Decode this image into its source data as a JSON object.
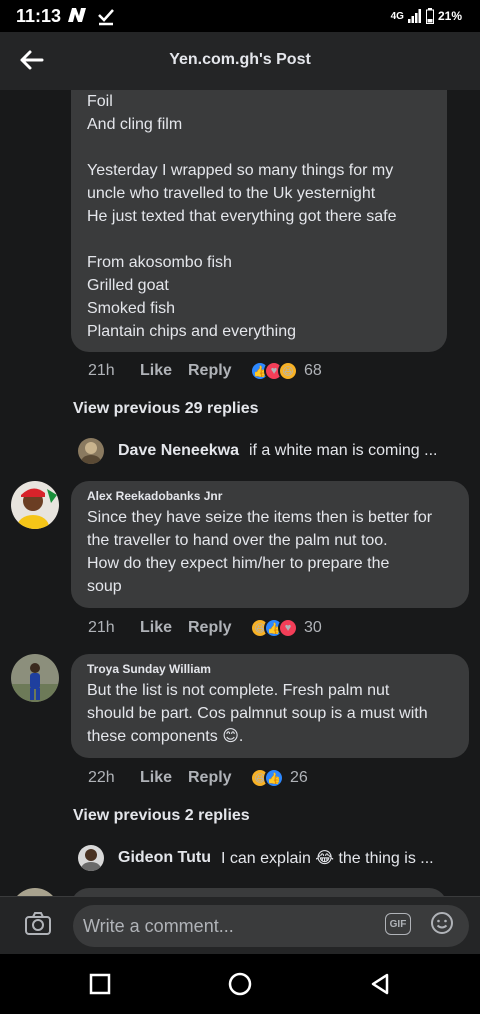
{
  "status_bar": {
    "time": "11:13",
    "network": "4G",
    "battery": "21%"
  },
  "header": {
    "title": "Yen.com.gh's Post"
  },
  "comment1": {
    "lines": [
      "Foil",
      "And cling film",
      "",
      "Yesterday I wrapped so many things for my",
      "uncle who travelled to the Uk yesternight",
      "He just texted that everything got there safe",
      "",
      "From akosombo fish",
      "Grilled goat",
      "Smoked fish",
      "Plantain chips and everything"
    ],
    "time": "21h",
    "like": "Like",
    "reply": "Reply",
    "reaction_count": "68",
    "view_previous": "View previous 29 replies",
    "reply_preview": {
      "name": "Dave Neneekwa",
      "text": "if a white man is coming ..."
    }
  },
  "comment2": {
    "author": "Alex Reekadobanks Jnr",
    "lines": [
      "Since they have seize the items then is better for",
      "the traveller to hand over the palm nut too.",
      "How do they expect him/her to prepare the",
      "soup"
    ],
    "time": "21h",
    "like": "Like",
    "reply": "Reply",
    "reaction_count": "30"
  },
  "comment3": {
    "author": "Troya Sunday William",
    "lines": [
      "But the list is not complete. Fresh palm nut",
      "should be part. Cos palmnut soup is a must with",
      "these components 😊."
    ],
    "time": "22h",
    "like": "Like",
    "reply": "Reply",
    "reaction_count": "26",
    "view_previous": "View previous 2 replies",
    "reply_preview": {
      "name": "Gideon Tutu",
      "text": "I can explain 😂 the thing is ..."
    }
  },
  "comment_bar": {
    "placeholder": "Write a comment...",
    "gif_label": "GIF"
  },
  "colors": {
    "background": "#18191a",
    "bubble": "#3a3b3c",
    "accent": "#2d88ff"
  }
}
